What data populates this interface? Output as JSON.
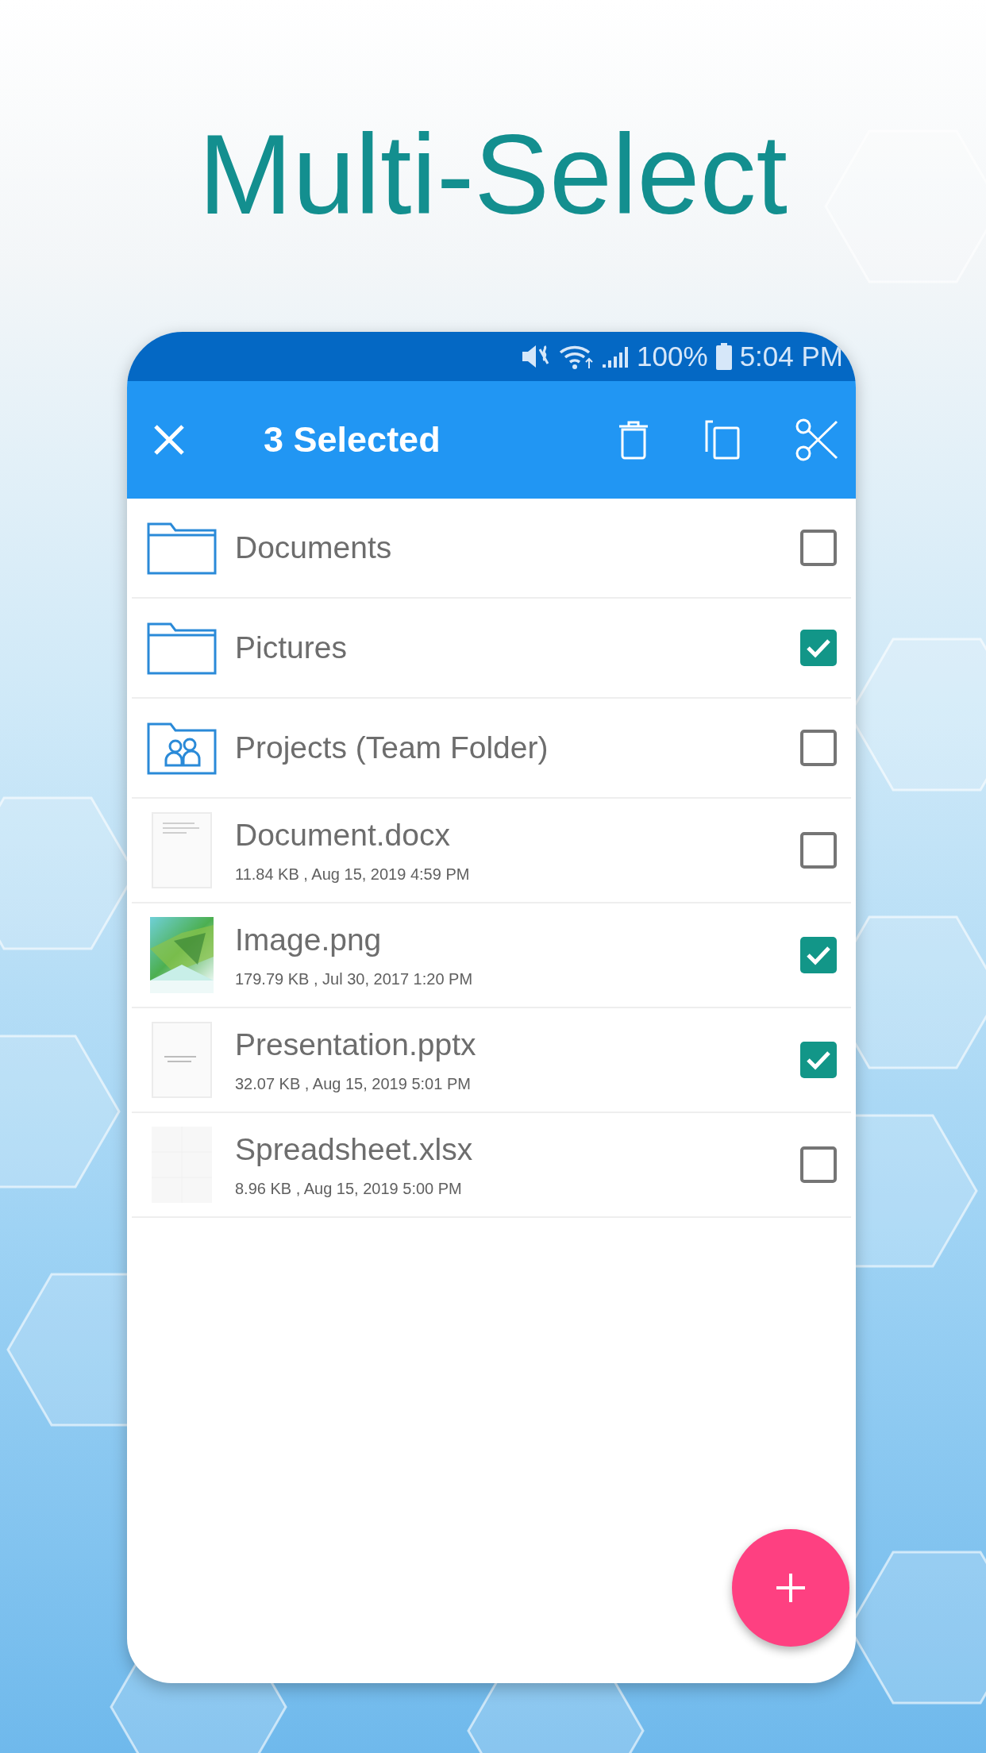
{
  "headline": "Multi-Select",
  "status_bar": {
    "battery_level_text": "100%",
    "time": "5:04 PM"
  },
  "toolbar": {
    "title": "3 Selected"
  },
  "items": [
    {
      "kind": "folder",
      "name": "Documents",
      "checked": false
    },
    {
      "kind": "folder",
      "name": "Pictures",
      "checked": true
    },
    {
      "kind": "team_folder",
      "name": "Projects (Team Folder)",
      "checked": false
    },
    {
      "kind": "document",
      "name": "Document.docx",
      "details": "11.84 KB , Aug 15, 2019 4:59 PM",
      "checked": false
    },
    {
      "name": "Image.png",
      "details": "179.79 KB , Jul 30, 2017 1:20 PM",
      "checked": true
    },
    {
      "kind": "presentation",
      "name": "Presentation.pptx",
      "details": "32.07 KB , Aug 15, 2019 5:01 PM",
      "checked": true
    },
    {
      "kind": "spreadsheet",
      "name": "Spreadsheet.xlsx",
      "details": "8.96 KB , Aug 15, 2019 5:00 PM",
      "checked": false
    }
  ]
}
